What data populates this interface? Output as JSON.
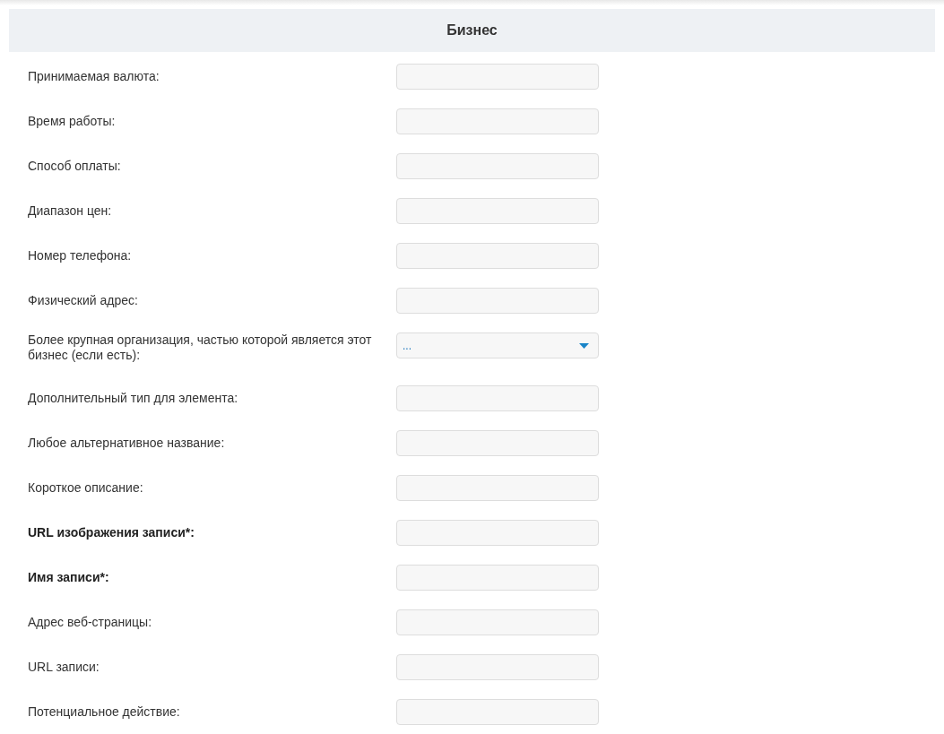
{
  "section": {
    "title": "Бизнес"
  },
  "fields": [
    {
      "label": "Принимаемая валюта:",
      "kind": "text",
      "required": false
    },
    {
      "label": "Время работы:",
      "kind": "text",
      "required": false
    },
    {
      "label": "Способ оплаты:",
      "kind": "text",
      "required": false
    },
    {
      "label": "Диапазон цен:",
      "kind": "text",
      "required": false
    },
    {
      "label": "Номер телефона:",
      "kind": "text",
      "required": false
    },
    {
      "label": "Физический адрес:",
      "kind": "text",
      "required": false
    },
    {
      "label": "Более крупная организация, частью которой является этот бизнес (если есть):",
      "kind": "select",
      "required": false,
      "value": "..."
    },
    {
      "label": "Дополнительный тип для элемента:",
      "kind": "text",
      "required": false
    },
    {
      "label": "Любое альтернативное название:",
      "kind": "text",
      "required": false
    },
    {
      "label": "Короткое описание:",
      "kind": "text",
      "required": false
    },
    {
      "label": "URL изображения записи*:",
      "kind": "text",
      "required": true
    },
    {
      "label": "Имя записи*:",
      "kind": "text",
      "required": true
    },
    {
      "label": "Адрес веб-страницы:",
      "kind": "text",
      "required": false
    },
    {
      "label": "URL записи:",
      "kind": "text",
      "required": false
    },
    {
      "label": "Потенциальное действие:",
      "kind": "text",
      "required": false
    }
  ]
}
